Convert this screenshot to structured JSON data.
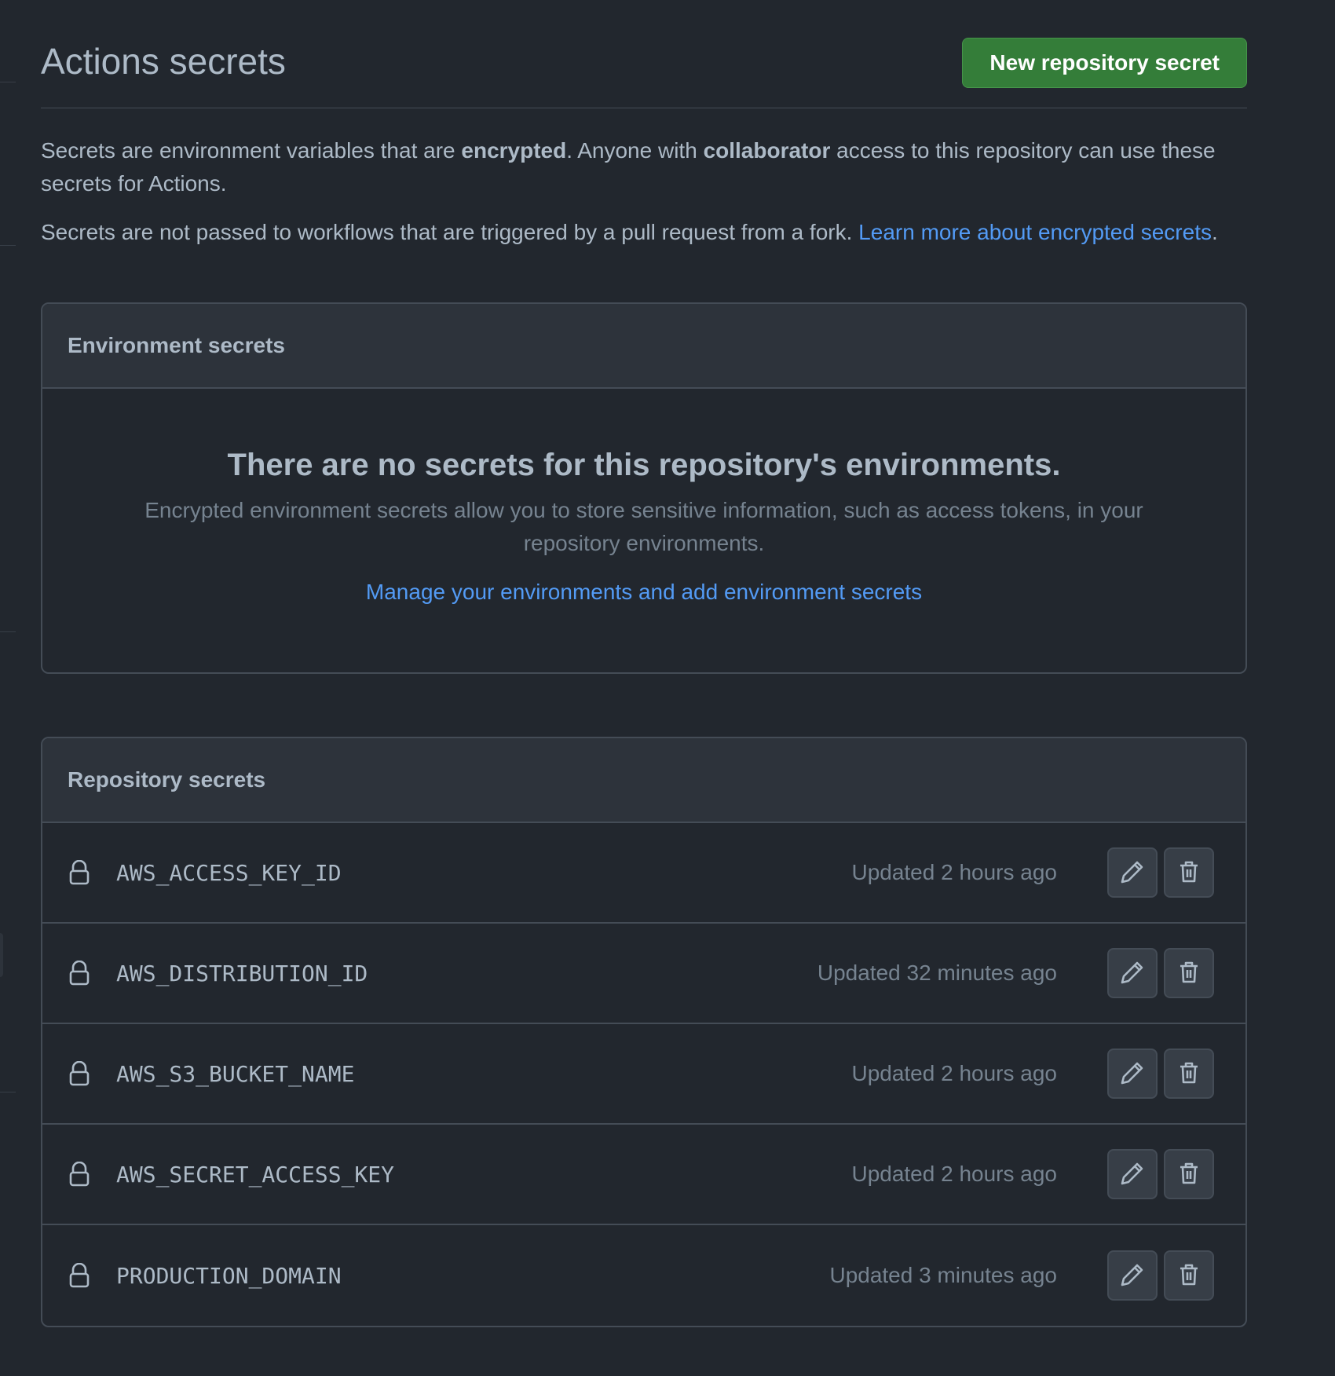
{
  "page": {
    "title": "Actions secrets",
    "new_secret_button": "New repository secret"
  },
  "description": {
    "p1_before": "Secrets are environment variables that are ",
    "p1_bold1": "encrypted",
    "p1_middle": ". Anyone with ",
    "p1_bold2": "collaborator",
    "p1_after": " access to this repository can use these secrets for Actions.",
    "p2_text": "Secrets are not passed to workflows that are triggered by a pull request from a fork. ",
    "p2_link": "Learn more about encrypted secrets",
    "p2_end": "."
  },
  "environment_secrets": {
    "title": "Environment secrets",
    "empty_title": "There are no secrets for this repository's environments.",
    "empty_description": "Encrypted environment secrets allow you to store sensitive information, such as access tokens, in your repository environments.",
    "manage_link": "Manage your environments and add environment secrets"
  },
  "repository_secrets": {
    "title": "Repository secrets",
    "items": [
      {
        "name": "AWS_ACCESS_KEY_ID",
        "updated": "Updated 2 hours ago"
      },
      {
        "name": "AWS_DISTRIBUTION_ID",
        "updated": "Updated 32 minutes ago"
      },
      {
        "name": "AWS_S3_BUCKET_NAME",
        "updated": "Updated 2 hours ago"
      },
      {
        "name": "AWS_SECRET_ACCESS_KEY",
        "updated": "Updated 2 hours ago"
      },
      {
        "name": "PRODUCTION_DOMAIN",
        "updated": "Updated 3 minutes ago"
      }
    ]
  },
  "icons": {
    "lock": "lock-icon",
    "edit": "pencil-icon",
    "delete": "trash-icon"
  },
  "colors": {
    "background": "#22272e",
    "box_header": "#2d333b",
    "border": "#444c56",
    "text": "#adbac7",
    "muted": "#768390",
    "link": "#539bf5",
    "primary_button": "#347d39"
  }
}
